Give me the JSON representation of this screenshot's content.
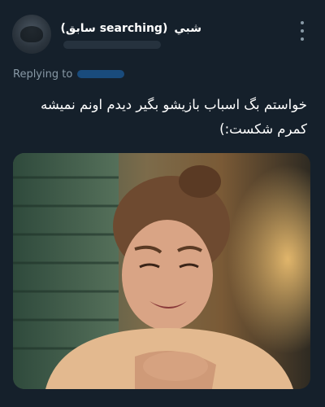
{
  "tweet": {
    "display_name": "شبي",
    "name_suffix": "(searching سابق)",
    "replying_label": "Replying to",
    "text": "خواستم بگ اسباب بازیشو بگیر دیدم اونم نمیشه کمرم شکست:)"
  },
  "icons": {
    "sprout": "sprout-icon",
    "menu": "more-vertical-icon"
  },
  "colors": {
    "background": "#15202b",
    "muted": "#8899a6",
    "link": "#1d9bf0",
    "sprout": "#4cc46b"
  }
}
